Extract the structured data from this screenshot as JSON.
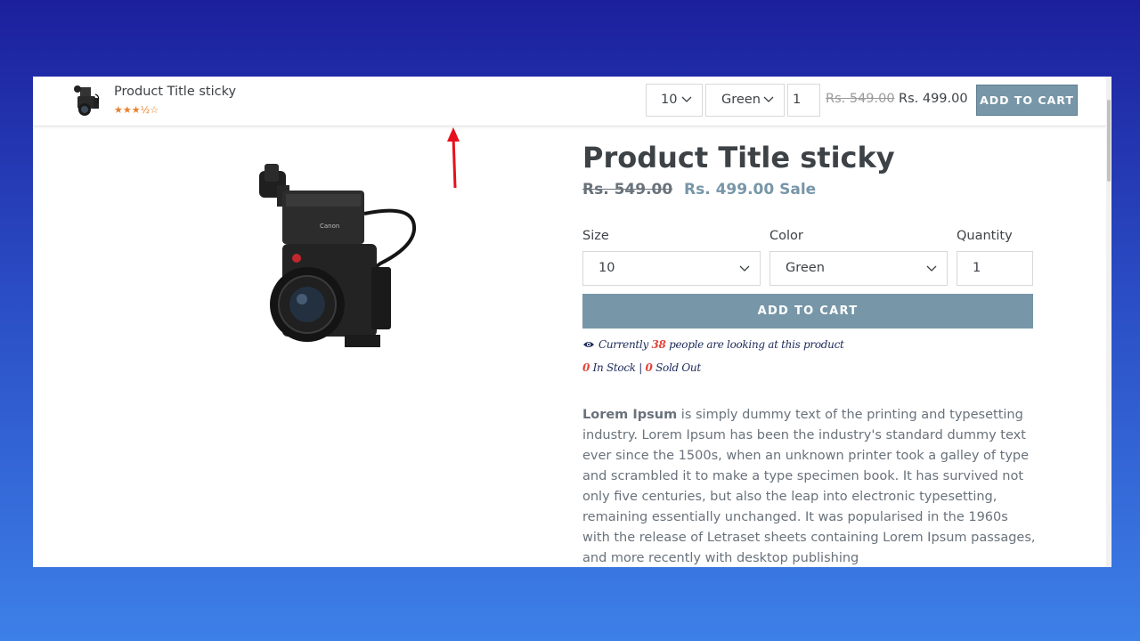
{
  "sticky_bar": {
    "title": "Product Title sticky",
    "rating_stars": "★★★½☆",
    "size_value": "10",
    "color_value": "Green",
    "quantity_value": "1",
    "compare_price": "Rs. 549.00",
    "price": "Rs. 499.00",
    "add_to_cart_label": "ADD TO CART"
  },
  "product": {
    "title": "Product Title sticky",
    "compare_price": "Rs. 549.00",
    "price": "Rs. 499.00 Sale",
    "size_label": "Size",
    "size_value": "10",
    "color_label": "Color",
    "color_value": "Green",
    "quantity_label": "Quantity",
    "quantity_value": "1",
    "add_to_cart_label": "ADD TO CART",
    "watching_prefix": "Currently",
    "watching_count": "38",
    "watching_suffix": "people are looking at this product",
    "in_stock_count": "0",
    "in_stock_label": "In Stock",
    "stock_separator": "|",
    "sold_out_count": "0",
    "sold_out_label": "Sold Out",
    "description_bold": "Lorem Ipsum",
    "description_rest": " is simply dummy text of the printing and typesetting industry. Lorem Ipsum has been the industry's standard dummy text ever since the 1500s, when an unknown printer took a galley of type and scrambled it to make a type specimen book. It has survived not only five centuries, but also the leap into electronic typesetting, remaining essentially unchanged. It was popularised in the 1960s with the release of Letraset sheets containing Lorem Ipsum passages, and more recently with desktop publishing"
  },
  "colors": {
    "accent": "#7796a8",
    "text": "#3d4246",
    "highlight": "#e2443a",
    "annotation_arrow": "#e8101c",
    "rating": "#e8802a"
  }
}
